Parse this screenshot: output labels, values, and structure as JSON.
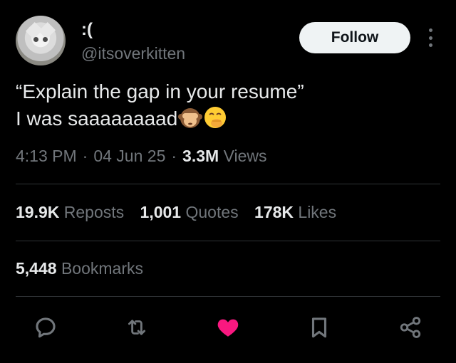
{
  "user": {
    "display_name": ":(",
    "handle": "@itsoverkitten"
  },
  "follow_button": {
    "label": "Follow"
  },
  "tweet": {
    "line1": "“Explain the gap in your resume”",
    "line2": "I was saaaaaaaad",
    "emojis": [
      "see-no-evil-monkey-emoji",
      "face-with-hand-over-mouth-emoji"
    ]
  },
  "meta": {
    "time": "4:13 PM",
    "separator": "·",
    "date": "04 Jun 25",
    "views_count": "3.3M",
    "views_label": "Views"
  },
  "stats": {
    "reposts_count": "19.9K",
    "reposts_label": "Reposts",
    "quotes_count": "1,001",
    "quotes_label": "Quotes",
    "likes_count": "178K",
    "likes_label": "Likes",
    "bookmarks_count": "5,448",
    "bookmarks_label": "Bookmarks"
  },
  "actions": [
    "reply-icon",
    "repost-icon",
    "like-icon",
    "bookmark-icon",
    "share-icon"
  ],
  "colors": {
    "background": "#000000",
    "text_primary": "#e7e9ea",
    "text_secondary": "#71767b",
    "divider": "#2f3336",
    "like": "#f91880",
    "follow_bg": "#eff3f4"
  }
}
